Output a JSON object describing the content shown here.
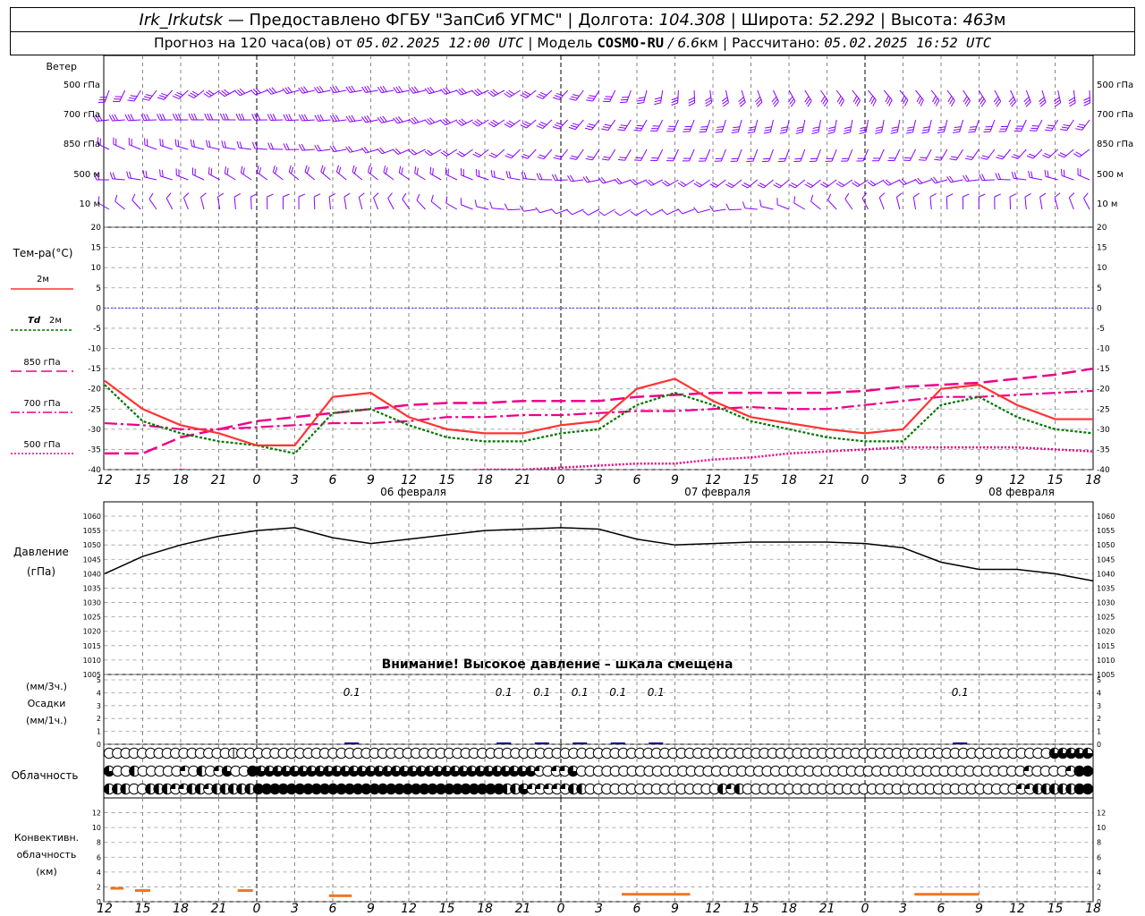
{
  "header": {
    "station": "Irk_Irkutsk",
    "dash": " — ",
    "provider": "Предоставлено ФГБУ \"ЗапСиб УГМС\"",
    "sep": " | ",
    "lon_label": "Долгота: ",
    "lon": "104.308",
    "lat_label": "Широта: ",
    "lat": "52.292",
    "alt_label": "Высота: ",
    "alt": "463",
    "alt_unit": "м"
  },
  "subheader": {
    "forecast_label": "Прогноз на 120 часа(ов) от ",
    "forecast_time": "05.02.2025 12:00 UTC",
    "model_label": " | Модель ",
    "model": "COSMO-RU",
    "res": " / 6.6",
    "res_unit": "км",
    "calc_label": " | Рассчитано: ",
    "calc_time": "05.02.2025 16:52 UTC"
  },
  "wind_panel": {
    "title": "Ветер",
    "levels": [
      "500 гПа",
      "700 гПа",
      "850 гПа",
      "500 м",
      "10  м"
    ]
  },
  "temp_panel": {
    "title": "Тем-ра(°C)",
    "legend": {
      "t2m": "2м",
      "td_prefix": "Td",
      "td2m": "2м",
      "t850": "850 гПа",
      "t700": "700 гПа",
      "t500": "500 гПа"
    }
  },
  "pressure_panel": {
    "title_line1": "Давление",
    "title_line2": "(гПа)",
    "warning": "Внимание! Высокое давление – шкала смещена"
  },
  "precip_panel": {
    "label1": "(мм/3ч.)",
    "label2": "Осадки",
    "label3": "(мм/1ч.)"
  },
  "cloud_panel": {
    "title": "Облачность"
  },
  "conv_panel": {
    "label1": "Конвективн.",
    "label2": "облачность",
    "label3": "(км)"
  },
  "colors": {
    "wind": "#8800ff",
    "t2m": "#ff3333",
    "td2m": "#007700",
    "t850": "#ee0088",
    "t700": "#ee0088",
    "t500": "#ee0088",
    "zero_line": "#3333ff",
    "pressure": "#000000",
    "precip": "#000099",
    "convective": "#ee7722"
  },
  "chart_data": [
    {
      "type": "line",
      "title": "Тем-ра(°C)",
      "x_ticks": [
        "12",
        "15",
        "18",
        "21",
        "0",
        "3",
        "6",
        "9",
        "12",
        "15",
        "18",
        "21",
        "0",
        "3",
        "6",
        "9",
        "12",
        "15",
        "18",
        "21",
        "0",
        "3",
        "6",
        "9",
        "12",
        "15",
        "18"
      ],
      "dates": [
        "06 февраля",
        "07 февраля",
        "08 февраля"
      ],
      "ylim": [
        -40,
        20
      ],
      "y_ticks": [
        20,
        15,
        10,
        5,
        0,
        -5,
        -10,
        -15,
        -20,
        -25,
        -30,
        -35,
        -40
      ],
      "series": [
        {
          "name": "2м",
          "values": [
            -18,
            -25,
            -29,
            -31,
            -34,
            -34,
            -22,
            -21,
            -27,
            -30,
            -31,
            -31,
            -29,
            -28,
            -20,
            -17.5,
            -23,
            -27,
            -28.5,
            -30,
            -31,
            -30,
            -20,
            -19,
            -24,
            -27.5,
            -27.5
          ]
        },
        {
          "name": "Td 2м",
          "values": [
            -19,
            -28,
            -31,
            -33,
            -34,
            -36,
            -26,
            -25,
            -29,
            -32,
            -33,
            -33,
            -31,
            -30,
            -24,
            -21,
            -24,
            -28,
            -30,
            -32,
            -33,
            -33,
            -24,
            -22,
            -27,
            -30,
            -31
          ]
        },
        {
          "name": "850 гПа",
          "values": [
            -36,
            -36,
            -32,
            -30,
            -28,
            -27,
            -26,
            -25,
            -24,
            -23.5,
            -23.5,
            -23,
            -23,
            -23,
            -22,
            -21.5,
            -21,
            -21,
            -21,
            -21,
            -20.5,
            -19.5,
            -19,
            -18.5,
            -17.5,
            -16.5,
            -15
          ]
        },
        {
          "name": "700 гПа",
          "values": [
            -28.5,
            -29,
            -30,
            -30,
            -29.5,
            -29,
            -28.5,
            -28.5,
            -28,
            -27,
            -27,
            -26.5,
            -26.5,
            -26,
            -25.5,
            -25.5,
            -25,
            -24.5,
            -25,
            -25,
            -24,
            -23,
            -22,
            -22,
            -21.5,
            -21,
            -20.5
          ]
        },
        {
          "name": "500 гПа",
          "values": [
            -41,
            -41,
            -40,
            -41,
            -42,
            -42,
            -42,
            -41,
            -41,
            -40.5,
            -40,
            -40,
            -39.5,
            -39,
            -38.5,
            -38.5,
            -37.5,
            -37,
            -36,
            -35.5,
            -35,
            -34.5,
            -34.5,
            -34.5,
            -34.5,
            -35,
            -35.5
          ]
        }
      ]
    },
    {
      "type": "line",
      "title": "Давление",
      "ylabel": "(гПа)",
      "ylim": [
        1005,
        1060
      ],
      "y_ticks": [
        1060,
        1055,
        1050,
        1045,
        1040,
        1035,
        1030,
        1025,
        1020,
        1015,
        1010,
        1005
      ],
      "series": [
        {
          "name": "Давление",
          "values": [
            1040,
            1046,
            1050,
            1053,
            1055,
            1056,
            1052.5,
            1050.5,
            1052,
            1053.5,
            1055,
            1055.5,
            1056,
            1055.5,
            1052,
            1050,
            1050.5,
            1051,
            1051,
            1051,
            1050.5,
            1049,
            1044,
            1041.5,
            1041.5,
            1040,
            1037.5
          ]
        }
      ]
    },
    {
      "type": "bar",
      "title": "Осадки",
      "ylim": [
        0,
        5
      ],
      "y_ticks": [
        5,
        4,
        3,
        2,
        1,
        0
      ],
      "labels": [
        {
          "x_index": 6.5,
          "text": "0.1"
        },
        {
          "x_index": 10.5,
          "text": "0.1"
        },
        {
          "x_index": 11.5,
          "text": "0.1"
        },
        {
          "x_index": 12.5,
          "text": "0.1"
        },
        {
          "x_index": 13.5,
          "text": "0.1"
        },
        {
          "x_index": 14.5,
          "text": "0.1"
        },
        {
          "x_index": 22.5,
          "text": "0.1"
        }
      ]
    },
    {
      "type": "bar",
      "title": "Облачность",
      "rows": [
        "ooooooooooooooopoooooooooooooooooooooooooooooooooooooooooooooooooooooooooooooooooooooooooooooooooooooooooooooooooottttt",
        "toohoooooqohoqtooftttttttttttttttttttttttttttttttttqoqqtoooooooooooooooooooooooooooooooooooooooooooooooooooooqooooqff",
        "hhhoohhhqqhhqhhhhhffffffffffffffffffffffffffffffhhtqqqqqhhoooooooooooooooohqhoooooooooooooooooooooooooooooooooqqhhhhhff"
      ]
    },
    {
      "type": "bar",
      "title": "Конвективн. облачность (км)",
      "ylim": [
        0,
        13
      ],
      "y_ticks": [
        12,
        10,
        8,
        6,
        4,
        2,
        0
      ],
      "segments": [
        {
          "x_start": 0.15,
          "x_end": 0.5,
          "value": 1.8
        },
        {
          "x_start": 0.8,
          "x_end": 1.2,
          "value": 1.5
        },
        {
          "x_start": 3.5,
          "x_end": 3.9,
          "value": 1.5
        },
        {
          "x_start": 5.9,
          "x_end": 6.5,
          "value": 0.8
        },
        {
          "x_start": 13.6,
          "x_end": 15.4,
          "value": 1.0
        },
        {
          "x_start": 21.3,
          "x_end": 23.0,
          "value": 1.0
        }
      ]
    }
  ]
}
